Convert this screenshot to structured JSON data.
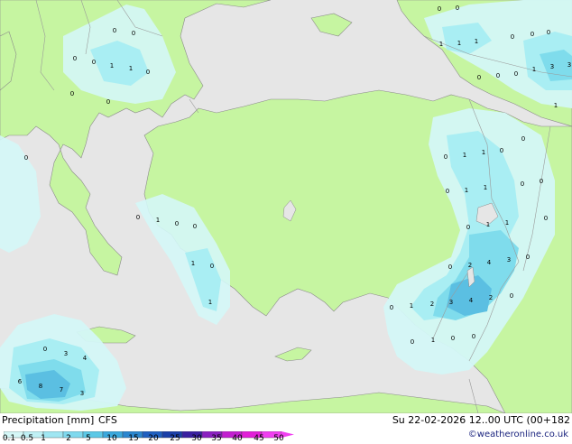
{
  "footer": {
    "title": "Precipitation [mm]",
    "model": "CFS",
    "datetime": "Su 22-02-2026 12..00 UTC (00+182",
    "credit": "©weatheronline.co.uk"
  },
  "legend": {
    "ticks": [
      "0.1",
      "0.5",
      "1",
      "2",
      "5",
      "10",
      "15",
      "20",
      "25",
      "30",
      "35",
      "40",
      "45",
      "50"
    ],
    "colors": [
      "#d4f7f7",
      "#bff0f5",
      "#9fe6f2",
      "#7fd9ee",
      "#5cc8e6",
      "#3aa8dc",
      "#2a86cf",
      "#1f5fc0",
      "#1a3fa8",
      "#3a20a0",
      "#8a1fc0",
      "#c21fd0",
      "#e21fd8",
      "#f03ff0"
    ]
  },
  "colors": {
    "sea": "#e6e6e6",
    "land": "#c6f5a1",
    "border": "#9a9a9a",
    "precip_light": "#d4f7f7",
    "precip_mid": "#a9eef3",
    "precip_strong": "#7fdcec",
    "precip_heavy": "#5bbfe2"
  },
  "precip_values": [
    {
      "v": "0"
    },
    {
      "v": "0"
    },
    {
      "v": "1"
    },
    {
      "v": "1"
    },
    {
      "v": "0"
    },
    {
      "v": "0"
    },
    {
      "v": "0"
    },
    {
      "v": "0"
    },
    {
      "v": "0"
    },
    {
      "v": "0"
    },
    {
      "v": "1"
    },
    {
      "v": "1"
    },
    {
      "v": "1"
    },
    {
      "v": "0"
    },
    {
      "v": "0"
    },
    {
      "v": "0"
    },
    {
      "v": "0"
    },
    {
      "v": "0"
    },
    {
      "v": "0"
    },
    {
      "v": "0"
    },
    {
      "v": "1"
    },
    {
      "v": "3"
    },
    {
      "v": "3"
    },
    {
      "v": "1"
    },
    {
      "v": "0"
    },
    {
      "v": "0"
    },
    {
      "v": "1"
    },
    {
      "v": "1"
    },
    {
      "v": "0"
    },
    {
      "v": "0"
    },
    {
      "v": "0"
    },
    {
      "v": "1"
    },
    {
      "v": "1"
    },
    {
      "v": "0"
    },
    {
      "v": "0"
    },
    {
      "v": "0"
    },
    {
      "v": "1"
    },
    {
      "v": "1"
    },
    {
      "v": "0"
    },
    {
      "v": "0"
    },
    {
      "v": "2"
    },
    {
      "v": "4"
    },
    {
      "v": "3"
    },
    {
      "v": "0"
    },
    {
      "v": "0"
    },
    {
      "v": "1"
    },
    {
      "v": "2"
    },
    {
      "v": "3"
    },
    {
      "v": "4"
    },
    {
      "v": "2"
    },
    {
      "v": "0"
    },
    {
      "v": "0"
    },
    {
      "v": "1"
    },
    {
      "v": "0"
    },
    {
      "v": "0"
    },
    {
      "v": "0"
    },
    {
      "v": "1"
    },
    {
      "v": "0"
    },
    {
      "v": "0"
    },
    {
      "v": "1"
    },
    {
      "v": "0"
    },
    {
      "v": "1"
    },
    {
      "v": "0"
    },
    {
      "v": "3"
    },
    {
      "v": "4"
    },
    {
      "v": "6"
    },
    {
      "v": "8"
    },
    {
      "v": "7"
    },
    {
      "v": "3"
    }
  ]
}
